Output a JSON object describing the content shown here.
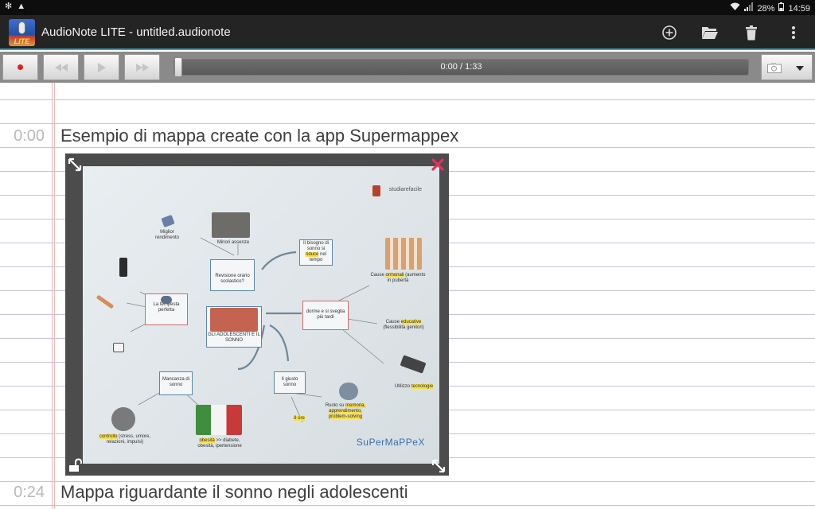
{
  "status_bar": {
    "battery": "28%",
    "time": "14:59",
    "icons": [
      "gear-icon",
      "warning-icon",
      "wifi-icon",
      "signal-icon",
      "battery-icon"
    ]
  },
  "app_bar": {
    "logo_text": "LITE",
    "title": "AudioNote LITE - untitled.audionote",
    "actions": [
      "add-circle-icon",
      "folder-open-icon",
      "trash-icon",
      "overflow-menu-icon"
    ]
  },
  "transport": {
    "buttons": [
      "record-button",
      "rewind-button",
      "play-button",
      "fast-forward-button"
    ],
    "time_label": "0:00 / 1:33",
    "progress": 0.0,
    "camera_icon": "camera-icon",
    "dropdown_icon": "dropdown-arrow-icon"
  },
  "notes": [
    {
      "timestamp": "0:00",
      "text": "Esempio di mappa create con la app Supermappex"
    },
    {
      "timestamp": "0:24",
      "text": "Mappa riguardante il sonno negli adolescenti"
    }
  ],
  "photo": {
    "nodes": {
      "center": "GLI ADOLESCENTI E IL SONNO",
      "revisione": "Revisione orario scolastico?",
      "tempesta": "La tempesta perfetta",
      "dorme": "dorme e si sveglia più tardi",
      "bisogno_pre": "Il bisogno di sonno si ",
      "bisogno_hl": "riduce",
      "bisogno_post": " nel tempo",
      "mancanza": "Mancanza di sonno",
      "giusto": "Il giusto sonno"
    },
    "labels": {
      "miglior": "Miglior rendimento",
      "minori": "Minori assenze",
      "cause1_pre": "Cause ",
      "cause1_hl": "ormonali",
      "cause1_post": " (aumento in pubertà",
      "cause2_pre": "Cause ",
      "cause2_hl": "educative",
      "cause2_post": " (flessibilità genitori)",
      "utilizzo_pre": "Utilizzo ",
      "utilizzo_hl": "tecnologie",
      "ruolo_pre": "Ruolo su ",
      "ruolo_hl": "memoria, apprendimento, problem-solving",
      "ore": "8 ore",
      "bottom1_hl": "controllo",
      "bottom1_post": " (stress, umore, relazioni, impulsi)",
      "bottom2_hl": "obesità",
      "bottom2_post": " >> diabete, obesità, ipertensione",
      "brand_sm": "SuPerMaPPeX",
      "brand_sf": "studiarefacile"
    },
    "corner_icons": [
      "expand-icon",
      "close-icon",
      "lock-open-icon",
      "resize-icon"
    ],
    "colors": {
      "close": "#e0335c",
      "accent": "#33a3c9",
      "record": "#e02020"
    }
  }
}
